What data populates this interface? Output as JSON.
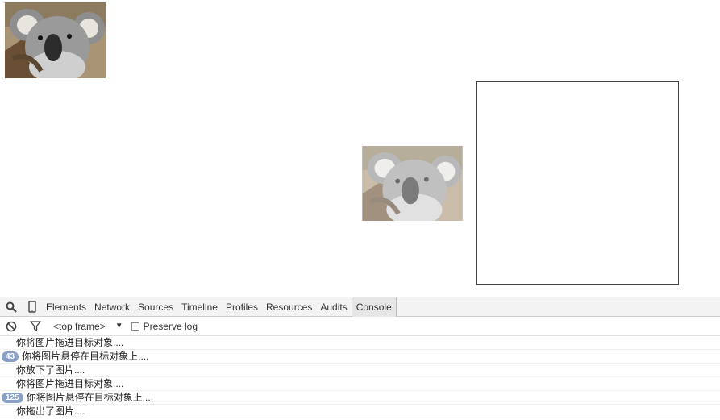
{
  "images": {
    "source_alt": "koala",
    "ghost_alt": "koala"
  },
  "devtools": {
    "tabs": [
      {
        "label": "Elements",
        "active": false
      },
      {
        "label": "Network",
        "active": false
      },
      {
        "label": "Sources",
        "active": false
      },
      {
        "label": "Timeline",
        "active": false
      },
      {
        "label": "Profiles",
        "active": false
      },
      {
        "label": "Resources",
        "active": false
      },
      {
        "label": "Audits",
        "active": false
      },
      {
        "label": "Console",
        "active": true
      }
    ],
    "toolbar": {
      "frame_select": "<top frame>",
      "frame_arrow": "▼",
      "preserve_log_label": "Preserve log",
      "preserve_log_checked": false
    },
    "icons": {
      "search": "search-icon",
      "device": "device-mode-icon",
      "clear": "clear-console-icon",
      "filter": "filter-icon"
    },
    "console": [
      {
        "count": "",
        "text": "你将图片拖进目标对象...."
      },
      {
        "count": "43",
        "text": "你将图片悬停在目标对象上...."
      },
      {
        "count": "",
        "text": "你放下了图片...."
      },
      {
        "count": "",
        "text": "你将图片拖进目标对象...."
      },
      {
        "count": "125",
        "text": "你将图片悬停在目标对象上...."
      },
      {
        "count": "",
        "text": "你拖出了图片...."
      }
    ],
    "badge_color": "#8aa0c8"
  }
}
